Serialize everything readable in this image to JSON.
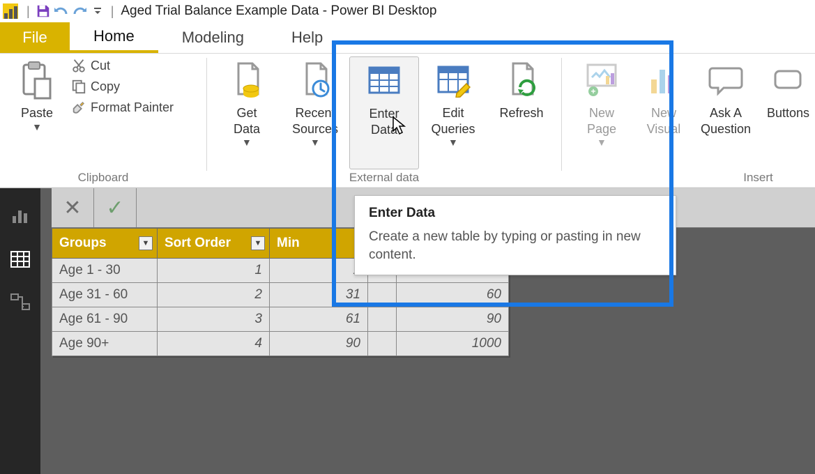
{
  "titlebar": {
    "title": "Aged Trial Balance Example Data - Power BI Desktop"
  },
  "menus": {
    "file": "File",
    "home": "Home",
    "modeling": "Modeling",
    "help": "Help"
  },
  "ribbon": {
    "clipboard": {
      "paste": "Paste",
      "cut": "Cut",
      "copy": "Copy",
      "format_painter": "Format Painter",
      "group_label": "Clipboard"
    },
    "external_data": {
      "get_data": "Get\nData",
      "recent_sources": "Recent\nSources",
      "enter_data": "Enter\nData",
      "edit_queries": "Edit\nQueries",
      "refresh": "Refresh",
      "group_label": "External data"
    },
    "insert": {
      "new_page": "New\nPage",
      "new_visual": "New\nVisual",
      "ask_a_question": "Ask A\nQuestion",
      "buttons": "Buttons",
      "group_label": "Insert"
    }
  },
  "tooltip": {
    "title": "Enter Data",
    "body": "Create a new table by typing or pasting in new content."
  },
  "table": {
    "headers": [
      "Groups",
      "Sort Order",
      "Min",
      "",
      ""
    ],
    "rows": [
      {
        "group": "Age 1 - 30",
        "sort": "1",
        "min": "1",
        "c3": "",
        "c4": "30"
      },
      {
        "group": "Age 31 - 60",
        "sort": "2",
        "min": "31",
        "c3": "",
        "c4": "60"
      },
      {
        "group": "Age 61 - 90",
        "sort": "3",
        "min": "61",
        "c3": "",
        "c4": "90"
      },
      {
        "group": "Age 90+",
        "sort": "4",
        "min": "90",
        "c3": "",
        "c4": "1000"
      }
    ]
  }
}
